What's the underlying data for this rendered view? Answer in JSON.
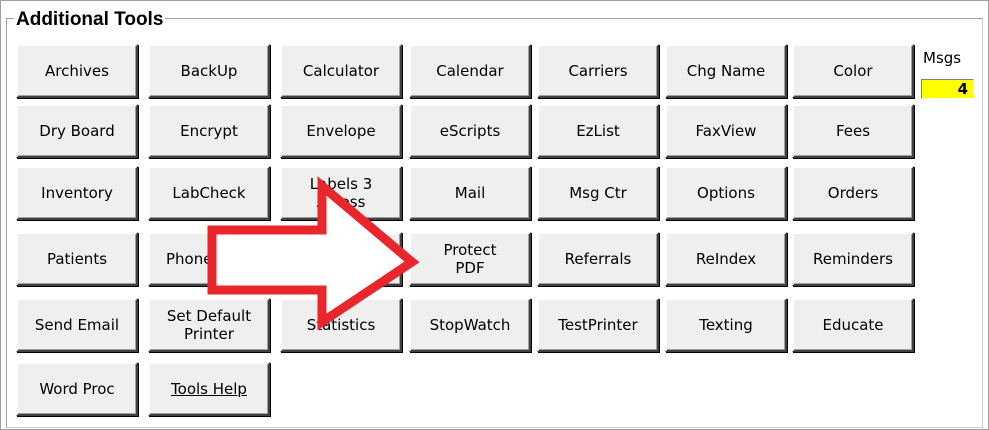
{
  "panel": {
    "title": "Additional Tools"
  },
  "msgs": {
    "label": "Msgs",
    "count": "4"
  },
  "buttons": [
    {
      "id": "archives",
      "label": "Archives"
    },
    {
      "id": "backup",
      "label": "BackUp"
    },
    {
      "id": "calculator",
      "label": "Calculator"
    },
    {
      "id": "calendar",
      "label": "Calendar"
    },
    {
      "id": "carriers",
      "label": "Carriers"
    },
    {
      "id": "chg-name",
      "label": "Chg Name"
    },
    {
      "id": "color",
      "label": "Color"
    },
    {
      "id": "dry-board",
      "label": "Dry  Board"
    },
    {
      "id": "encrypt",
      "label": "Encrypt"
    },
    {
      "id": "envelope",
      "label": "Envelope"
    },
    {
      "id": "escripts",
      "label": "eScripts"
    },
    {
      "id": "ezlist",
      "label": "EzList"
    },
    {
      "id": "faxview",
      "label": "FaxView"
    },
    {
      "id": "fees",
      "label": "Fees"
    },
    {
      "id": "inventory",
      "label": "Inventory"
    },
    {
      "id": "labcheck",
      "label": "LabCheck"
    },
    {
      "id": "labels-3-across",
      "label": "Labels 3\nAcross"
    },
    {
      "id": "mail",
      "label": "Mail"
    },
    {
      "id": "msg-ctr",
      "label": "Msg Ctr"
    },
    {
      "id": "options",
      "label": "Options"
    },
    {
      "id": "orders",
      "label": "Orders"
    },
    {
      "id": "patients",
      "label": "Patients"
    },
    {
      "id": "phone",
      "label": "Phone"
    },
    {
      "id": "hidden-tool",
      "label": ""
    },
    {
      "id": "protect-pdf",
      "label": "Protect\nPDF"
    },
    {
      "id": "referrals",
      "label": "Referrals"
    },
    {
      "id": "reindex",
      "label": "ReIndex"
    },
    {
      "id": "reminders",
      "label": "Reminders"
    },
    {
      "id": "send-email",
      "label": "Send Email"
    },
    {
      "id": "set-default-printer",
      "label": "Set Default\nPrinter"
    },
    {
      "id": "statistics",
      "label": "Statistics"
    },
    {
      "id": "stopwatch",
      "label": "StopWatch"
    },
    {
      "id": "testprinter",
      "label": "TestPrinter"
    },
    {
      "id": "texting",
      "label": "Texting"
    },
    {
      "id": "educate",
      "label": "Educate"
    },
    {
      "id": "word-proc",
      "label": "Word Proc"
    },
    {
      "id": "tools-help",
      "label": "Tools Help"
    }
  ],
  "colors": {
    "arrow_stroke": "#e8262b",
    "arrow_fill": "#ffffff",
    "msgs_bg": "#ffff00",
    "button_face": "#efefef"
  },
  "icons": {
    "callout": "arrow-right-icon"
  }
}
